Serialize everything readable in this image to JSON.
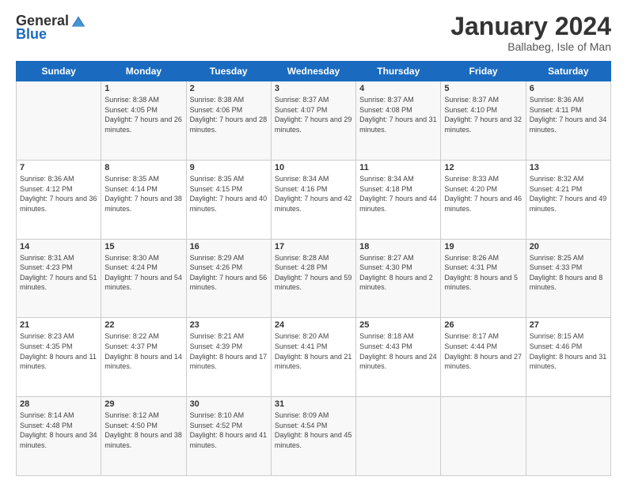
{
  "header": {
    "logo_line1": "General",
    "logo_line2": "Blue",
    "month_title": "January 2024",
    "location": "Ballabeg, Isle of Man"
  },
  "days_of_week": [
    "Sunday",
    "Monday",
    "Tuesday",
    "Wednesday",
    "Thursday",
    "Friday",
    "Saturday"
  ],
  "weeks": [
    [
      {
        "day": "",
        "sunrise": "",
        "sunset": "",
        "daylight": "",
        "empty": true
      },
      {
        "day": "1",
        "sunrise": "Sunrise: 8:38 AM",
        "sunset": "Sunset: 4:05 PM",
        "daylight": "Daylight: 7 hours and 26 minutes.",
        "empty": false
      },
      {
        "day": "2",
        "sunrise": "Sunrise: 8:38 AM",
        "sunset": "Sunset: 4:06 PM",
        "daylight": "Daylight: 7 hours and 28 minutes.",
        "empty": false
      },
      {
        "day": "3",
        "sunrise": "Sunrise: 8:37 AM",
        "sunset": "Sunset: 4:07 PM",
        "daylight": "Daylight: 7 hours and 29 minutes.",
        "empty": false
      },
      {
        "day": "4",
        "sunrise": "Sunrise: 8:37 AM",
        "sunset": "Sunset: 4:08 PM",
        "daylight": "Daylight: 7 hours and 31 minutes.",
        "empty": false
      },
      {
        "day": "5",
        "sunrise": "Sunrise: 8:37 AM",
        "sunset": "Sunset: 4:10 PM",
        "daylight": "Daylight: 7 hours and 32 minutes.",
        "empty": false
      },
      {
        "day": "6",
        "sunrise": "Sunrise: 8:36 AM",
        "sunset": "Sunset: 4:11 PM",
        "daylight": "Daylight: 7 hours and 34 minutes.",
        "empty": false
      }
    ],
    [
      {
        "day": "7",
        "sunrise": "Sunrise: 8:36 AM",
        "sunset": "Sunset: 4:12 PM",
        "daylight": "Daylight: 7 hours and 36 minutes.",
        "empty": false
      },
      {
        "day": "8",
        "sunrise": "Sunrise: 8:35 AM",
        "sunset": "Sunset: 4:14 PM",
        "daylight": "Daylight: 7 hours and 38 minutes.",
        "empty": false
      },
      {
        "day": "9",
        "sunrise": "Sunrise: 8:35 AM",
        "sunset": "Sunset: 4:15 PM",
        "daylight": "Daylight: 7 hours and 40 minutes.",
        "empty": false
      },
      {
        "day": "10",
        "sunrise": "Sunrise: 8:34 AM",
        "sunset": "Sunset: 4:16 PM",
        "daylight": "Daylight: 7 hours and 42 minutes.",
        "empty": false
      },
      {
        "day": "11",
        "sunrise": "Sunrise: 8:34 AM",
        "sunset": "Sunset: 4:18 PM",
        "daylight": "Daylight: 7 hours and 44 minutes.",
        "empty": false
      },
      {
        "day": "12",
        "sunrise": "Sunrise: 8:33 AM",
        "sunset": "Sunset: 4:20 PM",
        "daylight": "Daylight: 7 hours and 46 minutes.",
        "empty": false
      },
      {
        "day": "13",
        "sunrise": "Sunrise: 8:32 AM",
        "sunset": "Sunset: 4:21 PM",
        "daylight": "Daylight: 7 hours and 49 minutes.",
        "empty": false
      }
    ],
    [
      {
        "day": "14",
        "sunrise": "Sunrise: 8:31 AM",
        "sunset": "Sunset: 4:23 PM",
        "daylight": "Daylight: 7 hours and 51 minutes.",
        "empty": false
      },
      {
        "day": "15",
        "sunrise": "Sunrise: 8:30 AM",
        "sunset": "Sunset: 4:24 PM",
        "daylight": "Daylight: 7 hours and 54 minutes.",
        "empty": false
      },
      {
        "day": "16",
        "sunrise": "Sunrise: 8:29 AM",
        "sunset": "Sunset: 4:26 PM",
        "daylight": "Daylight: 7 hours and 56 minutes.",
        "empty": false
      },
      {
        "day": "17",
        "sunrise": "Sunrise: 8:28 AM",
        "sunset": "Sunset: 4:28 PM",
        "daylight": "Daylight: 7 hours and 59 minutes.",
        "empty": false
      },
      {
        "day": "18",
        "sunrise": "Sunrise: 8:27 AM",
        "sunset": "Sunset: 4:30 PM",
        "daylight": "Daylight: 8 hours and 2 minutes.",
        "empty": false
      },
      {
        "day": "19",
        "sunrise": "Sunrise: 8:26 AM",
        "sunset": "Sunset: 4:31 PM",
        "daylight": "Daylight: 8 hours and 5 minutes.",
        "empty": false
      },
      {
        "day": "20",
        "sunrise": "Sunrise: 8:25 AM",
        "sunset": "Sunset: 4:33 PM",
        "daylight": "Daylight: 8 hours and 8 minutes.",
        "empty": false
      }
    ],
    [
      {
        "day": "21",
        "sunrise": "Sunrise: 8:23 AM",
        "sunset": "Sunset: 4:35 PM",
        "daylight": "Daylight: 8 hours and 11 minutes.",
        "empty": false
      },
      {
        "day": "22",
        "sunrise": "Sunrise: 8:22 AM",
        "sunset": "Sunset: 4:37 PM",
        "daylight": "Daylight: 8 hours and 14 minutes.",
        "empty": false
      },
      {
        "day": "23",
        "sunrise": "Sunrise: 8:21 AM",
        "sunset": "Sunset: 4:39 PM",
        "daylight": "Daylight: 8 hours and 17 minutes.",
        "empty": false
      },
      {
        "day": "24",
        "sunrise": "Sunrise: 8:20 AM",
        "sunset": "Sunset: 4:41 PM",
        "daylight": "Daylight: 8 hours and 21 minutes.",
        "empty": false
      },
      {
        "day": "25",
        "sunrise": "Sunrise: 8:18 AM",
        "sunset": "Sunset: 4:43 PM",
        "daylight": "Daylight: 8 hours and 24 minutes.",
        "empty": false
      },
      {
        "day": "26",
        "sunrise": "Sunrise: 8:17 AM",
        "sunset": "Sunset: 4:44 PM",
        "daylight": "Daylight: 8 hours and 27 minutes.",
        "empty": false
      },
      {
        "day": "27",
        "sunrise": "Sunrise: 8:15 AM",
        "sunset": "Sunset: 4:46 PM",
        "daylight": "Daylight: 8 hours and 31 minutes.",
        "empty": false
      }
    ],
    [
      {
        "day": "28",
        "sunrise": "Sunrise: 8:14 AM",
        "sunset": "Sunset: 4:48 PM",
        "daylight": "Daylight: 8 hours and 34 minutes.",
        "empty": false
      },
      {
        "day": "29",
        "sunrise": "Sunrise: 8:12 AM",
        "sunset": "Sunset: 4:50 PM",
        "daylight": "Daylight: 8 hours and 38 minutes.",
        "empty": false
      },
      {
        "day": "30",
        "sunrise": "Sunrise: 8:10 AM",
        "sunset": "Sunset: 4:52 PM",
        "daylight": "Daylight: 8 hours and 41 minutes.",
        "empty": false
      },
      {
        "day": "31",
        "sunrise": "Sunrise: 8:09 AM",
        "sunset": "Sunset: 4:54 PM",
        "daylight": "Daylight: 8 hours and 45 minutes.",
        "empty": false
      },
      {
        "day": "",
        "sunrise": "",
        "sunset": "",
        "daylight": "",
        "empty": true
      },
      {
        "day": "",
        "sunrise": "",
        "sunset": "",
        "daylight": "",
        "empty": true
      },
      {
        "day": "",
        "sunrise": "",
        "sunset": "",
        "daylight": "",
        "empty": true
      }
    ]
  ]
}
